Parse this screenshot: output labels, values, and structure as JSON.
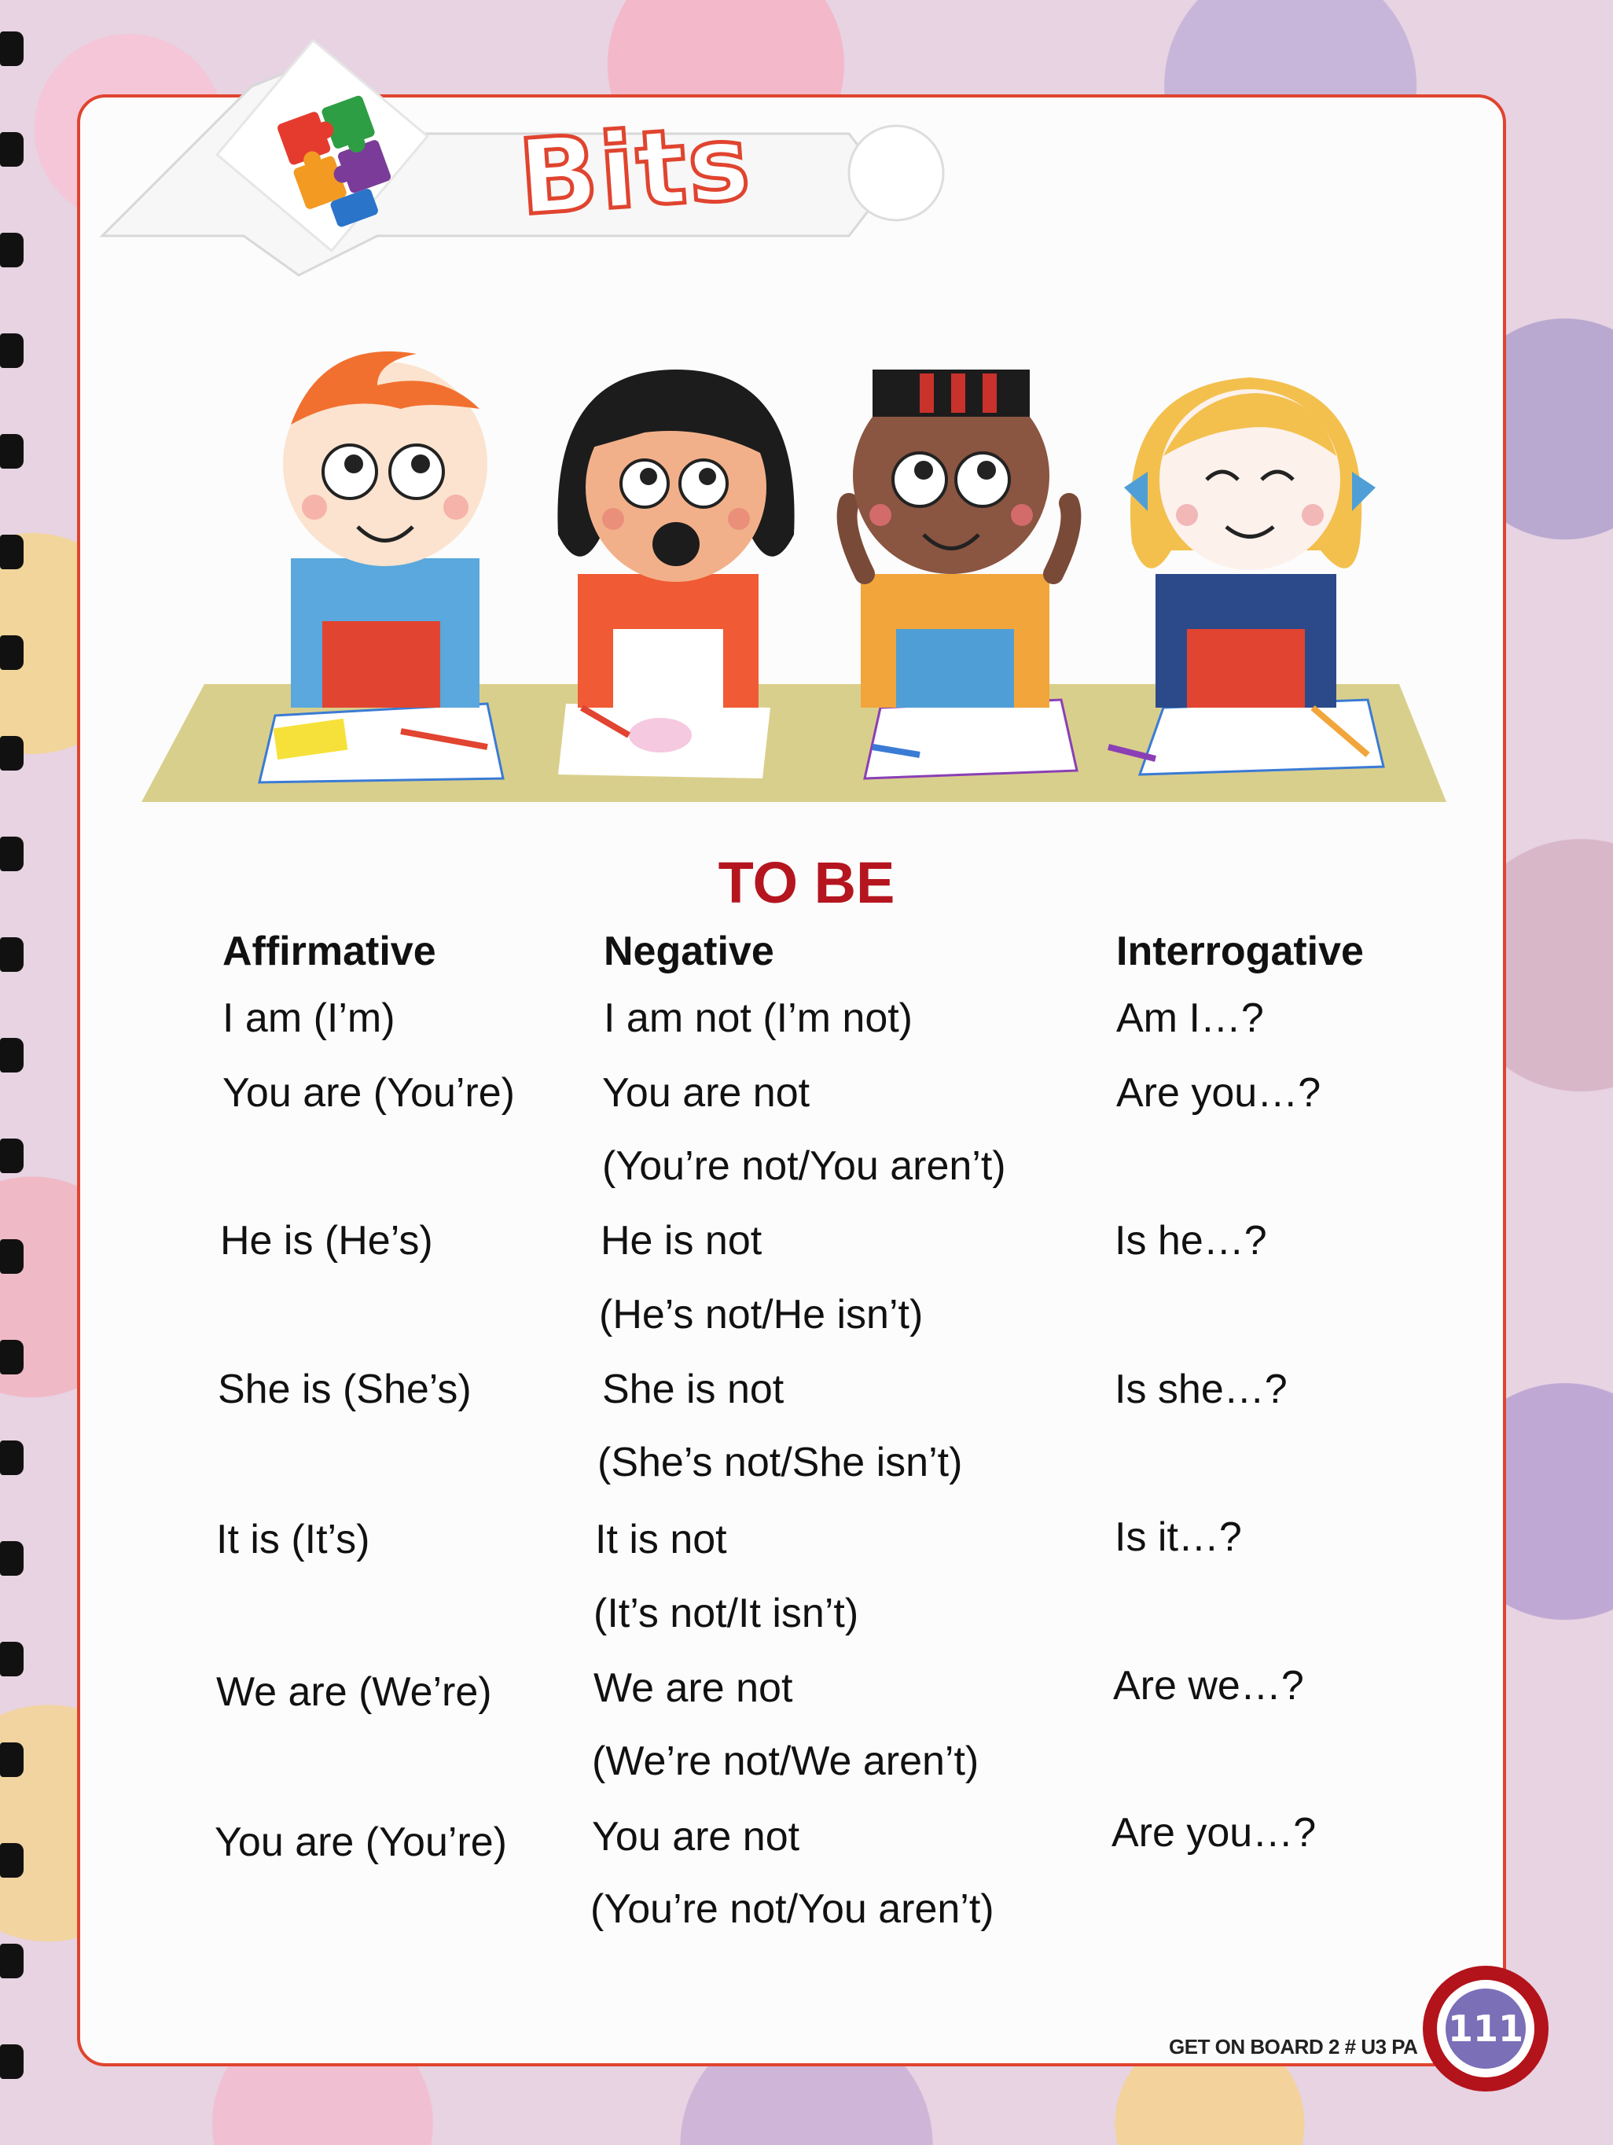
{
  "header": {
    "title": "Bits"
  },
  "section_title": "TO BE",
  "columns": {
    "affirmative": "Affirmative",
    "negative": "Negative",
    "interrogative": "Interrogative"
  },
  "rows": [
    {
      "affirmative": "I am  (I’m)",
      "negative": "I am not (I’m not)",
      "negative2": "",
      "interrogative": "Am I…?"
    },
    {
      "affirmative": "You are (You’re)",
      "negative": "You are not",
      "negative2": "(You’re not/You aren’t)",
      "interrogative": "Are you…?"
    },
    {
      "affirmative": "He is (He’s)",
      "negative": "He is not",
      "negative2": "(He’s not/He isn’t)",
      "interrogative": "Is he…?"
    },
    {
      "affirmative": "She is (She’s)",
      "negative": "She is not",
      "negative2": "(She’s not/She isn’t)",
      "interrogative": "Is she…?"
    },
    {
      "affirmative": "It is (It’s)",
      "negative": "It is not",
      "negative2": "(It’s not/It isn’t)",
      "interrogative": "Is it…?"
    },
    {
      "affirmative": "We are (We’re)",
      "negative": "We are not",
      "negative2": "(We’re not/We aren’t)",
      "interrogative": "Are we…?"
    },
    {
      "affirmative": "You are (You’re)",
      "negative": "You are not",
      "negative2": "(You’re not/You aren’t)",
      "interrogative": "Are you…?"
    }
  ],
  "footer": {
    "book": "GET ON BOARD 2 # U3 PA",
    "page_number": "111"
  },
  "colors": {
    "border": "#e0442f",
    "title": "#b5151f",
    "badge": "#b3131b",
    "badge_inner": "#7b6fb8"
  }
}
